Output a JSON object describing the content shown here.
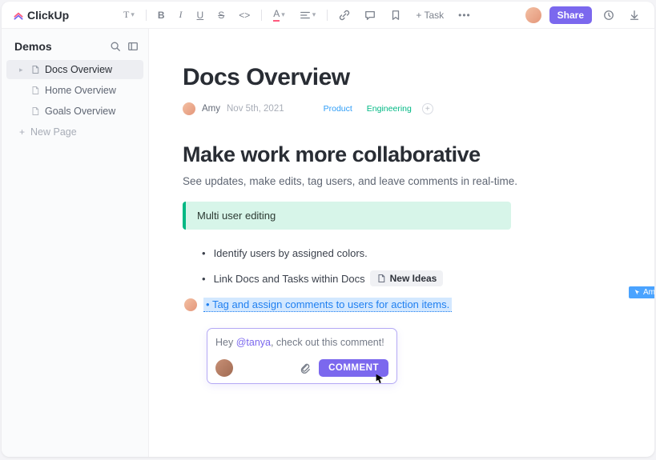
{
  "brand": "ClickUp",
  "toolbar": {
    "text_tool": "T",
    "task_button": "+ Task",
    "more": "•••"
  },
  "header": {
    "share_label": "Share"
  },
  "sidebar": {
    "title": "Demos",
    "items": [
      {
        "label": "Docs Overview",
        "active": true,
        "expandable": true
      },
      {
        "label": "Home Overview",
        "active": false,
        "expandable": false
      },
      {
        "label": "Goals Overview",
        "active": false,
        "expandable": false
      }
    ],
    "new_page_label": "New Page"
  },
  "doc": {
    "title": "Docs Overview",
    "author": "Amy",
    "date": "Nov 5th, 2021",
    "tags": {
      "product": "Product",
      "engineering": "Engineering"
    },
    "h2": "Make work more collaborative",
    "lead": "See updates, make edits, tag users, and leave comments in real-time.",
    "callout": "Multi user editing",
    "bullets": {
      "b1": "Identify users by assigned colors.",
      "b2": "Link Docs and Tasks within Docs",
      "task_chip": "New Ideas",
      "b3": "Tag and assign comments to users for action items."
    },
    "selection_user": "Amy"
  },
  "comment": {
    "prefix": "Hey ",
    "mention": "@tanya",
    "suffix": ", check out this comment!",
    "button": "COMMENT"
  }
}
